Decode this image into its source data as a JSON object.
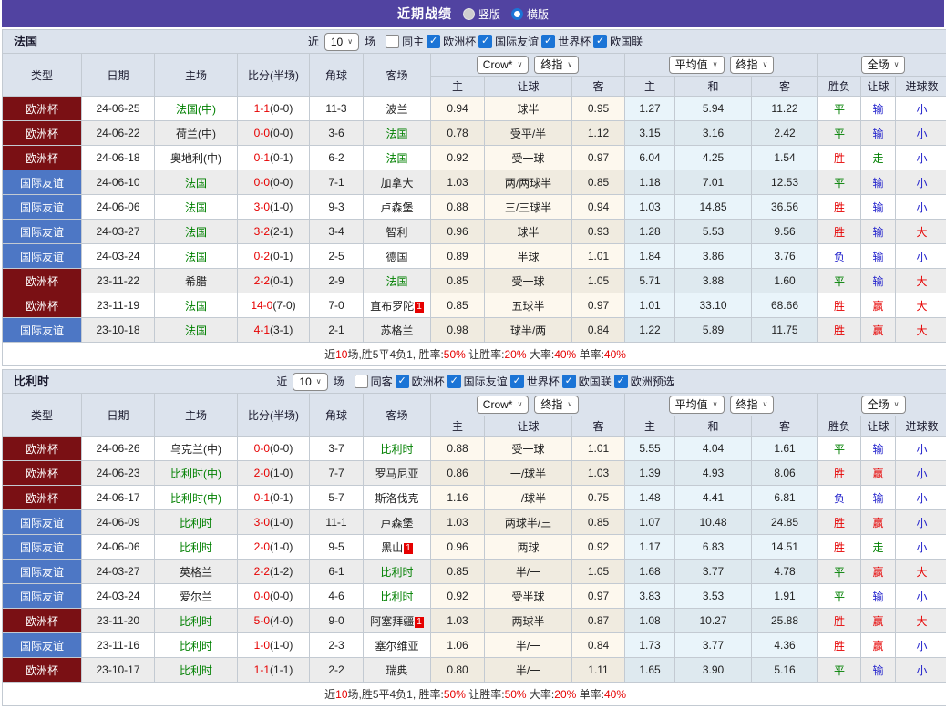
{
  "page": {
    "title": "近期战绩",
    "radios": [
      {
        "label": "竖版",
        "selected": false
      },
      {
        "label": "横版",
        "selected": true
      }
    ]
  },
  "header": {
    "base": [
      "类型",
      "日期",
      "主场",
      "比分(半场)",
      "角球",
      "客场"
    ],
    "groups": [
      {
        "dropdowns": [
          "Crow*",
          "终指"
        ],
        "sub": [
          "主",
          "让球",
          "客"
        ]
      },
      {
        "dropdowns": [
          "平均值",
          "终指"
        ],
        "sub": [
          "主",
          "和",
          "客"
        ]
      },
      {
        "dropdowns": [
          "全场"
        ],
        "sub": [
          "胜负",
          "让球",
          "进球数"
        ]
      }
    ]
  },
  "colors": {
    "topbar": "#5143a1",
    "league_euro": "#7a1014",
    "league_friendly": "#4d77c5",
    "focus_team": "#008000",
    "score": "#e60000",
    "result_map": {
      "胜": "#e60000",
      "平": "#008000",
      "负": "#2222cc",
      "赢": "#e60000",
      "走": "#008000",
      "输": "#2222cc",
      "大": "#e60000",
      "小": "#2222cc"
    }
  },
  "sections": [
    {
      "team": "法国",
      "filter": {
        "prefix": "近",
        "count": "10",
        "suffix": "场",
        "same": {
          "label": "同主",
          "checked": false
        },
        "leagues": [
          {
            "label": "欧洲杯",
            "checked": true
          },
          {
            "label": "国际友谊",
            "checked": true
          },
          {
            "label": "世界杯",
            "checked": true
          },
          {
            "label": "欧国联",
            "checked": true
          }
        ]
      },
      "rows": [
        {
          "league": "欧洲杯",
          "lc": "red",
          "date": "24-06-25",
          "home": "法国(中)",
          "hf": true,
          "score": "1-1",
          "half": "(0-0)",
          "corners": "11-3",
          "away": "波兰",
          "af": false,
          "rc": null,
          "crow": [
            "0.94",
            "球半",
            "0.95"
          ],
          "avg": [
            "1.27",
            "5.94",
            "11.22"
          ],
          "res": [
            "平",
            "输",
            "小"
          ]
        },
        {
          "league": "欧洲杯",
          "lc": "red",
          "date": "24-06-22",
          "home": "荷兰(中)",
          "hf": false,
          "score": "0-0",
          "half": "(0-0)",
          "corners": "3-6",
          "away": "法国",
          "af": true,
          "rc": null,
          "crow": [
            "0.78",
            "受平/半",
            "1.12"
          ],
          "avg": [
            "3.15",
            "3.16",
            "2.42"
          ],
          "res": [
            "平",
            "输",
            "小"
          ]
        },
        {
          "league": "欧洲杯",
          "lc": "red",
          "date": "24-06-18",
          "home": "奥地利(中)",
          "hf": false,
          "score": "0-1",
          "half": "(0-1)",
          "corners": "6-2",
          "away": "法国",
          "af": true,
          "rc": null,
          "crow": [
            "0.92",
            "受一球",
            "0.97"
          ],
          "avg": [
            "6.04",
            "4.25",
            "1.54"
          ],
          "res": [
            "胜",
            "走",
            "小"
          ]
        },
        {
          "league": "国际友谊",
          "lc": "blue",
          "date": "24-06-10",
          "home": "法国",
          "hf": true,
          "score": "0-0",
          "half": "(0-0)",
          "corners": "7-1",
          "away": "加拿大",
          "af": false,
          "rc": null,
          "crow": [
            "1.03",
            "两/两球半",
            "0.85"
          ],
          "avg": [
            "1.18",
            "7.01",
            "12.53"
          ],
          "res": [
            "平",
            "输",
            "小"
          ]
        },
        {
          "league": "国际友谊",
          "lc": "blue",
          "date": "24-06-06",
          "home": "法国",
          "hf": true,
          "score": "3-0",
          "half": "(1-0)",
          "corners": "9-3",
          "away": "卢森堡",
          "af": false,
          "rc": null,
          "crow": [
            "0.88",
            "三/三球半",
            "0.94"
          ],
          "avg": [
            "1.03",
            "14.85",
            "36.56"
          ],
          "res": [
            "胜",
            "输",
            "小"
          ]
        },
        {
          "league": "国际友谊",
          "lc": "blue",
          "date": "24-03-27",
          "home": "法国",
          "hf": true,
          "score": "3-2",
          "half": "(2-1)",
          "corners": "3-4",
          "away": "智利",
          "af": false,
          "rc": null,
          "crow": [
            "0.96",
            "球半",
            "0.93"
          ],
          "avg": [
            "1.28",
            "5.53",
            "9.56"
          ],
          "res": [
            "胜",
            "输",
            "大"
          ]
        },
        {
          "league": "国际友谊",
          "lc": "blue",
          "date": "24-03-24",
          "home": "法国",
          "hf": true,
          "score": "0-2",
          "half": "(0-1)",
          "corners": "2-5",
          "away": "德国",
          "af": false,
          "rc": null,
          "crow": [
            "0.89",
            "半球",
            "1.01"
          ],
          "avg": [
            "1.84",
            "3.86",
            "3.76"
          ],
          "res": [
            "负",
            "输",
            "小"
          ]
        },
        {
          "league": "欧洲杯",
          "lc": "red",
          "date": "23-11-22",
          "home": "希腊",
          "hf": false,
          "score": "2-2",
          "half": "(0-1)",
          "corners": "2-9",
          "away": "法国",
          "af": true,
          "rc": null,
          "crow": [
            "0.85",
            "受一球",
            "1.05"
          ],
          "avg": [
            "5.71",
            "3.88",
            "1.60"
          ],
          "res": [
            "平",
            "输",
            "大"
          ]
        },
        {
          "league": "欧洲杯",
          "lc": "red",
          "date": "23-11-19",
          "home": "法国",
          "hf": true,
          "score": "14-0",
          "half": "(7-0)",
          "corners": "7-0",
          "away": "直布罗陀",
          "af": false,
          "rc": "1",
          "crow": [
            "0.85",
            "五球半",
            "0.97"
          ],
          "avg": [
            "1.01",
            "33.10",
            "68.66"
          ],
          "res": [
            "胜",
            "赢",
            "大"
          ]
        },
        {
          "league": "国际友谊",
          "lc": "blue",
          "date": "23-10-18",
          "home": "法国",
          "hf": true,
          "score": "4-1",
          "half": "(3-1)",
          "corners": "2-1",
          "away": "苏格兰",
          "af": false,
          "rc": null,
          "crow": [
            "0.98",
            "球半/两",
            "0.84"
          ],
          "avg": [
            "1.22",
            "5.89",
            "11.75"
          ],
          "res": [
            "胜",
            "赢",
            "大"
          ]
        }
      ],
      "summary": [
        [
          "近",
          "n"
        ],
        [
          "10",
          "r"
        ],
        [
          "场,胜5平4负1, 胜率:",
          "n"
        ],
        [
          "50%",
          "r"
        ],
        [
          " 让胜率:",
          "n"
        ],
        [
          "20%",
          "r"
        ],
        [
          " 大率:",
          "n"
        ],
        [
          "40%",
          "r"
        ],
        [
          " 单率:",
          "n"
        ],
        [
          "40%",
          "r"
        ]
      ]
    },
    {
      "team": "比利时",
      "filter": {
        "prefix": "近",
        "count": "10",
        "suffix": "场",
        "same": {
          "label": "同客",
          "checked": false
        },
        "leagues": [
          {
            "label": "欧洲杯",
            "checked": true
          },
          {
            "label": "国际友谊",
            "checked": true
          },
          {
            "label": "世界杯",
            "checked": true
          },
          {
            "label": "欧国联",
            "checked": true
          },
          {
            "label": "欧洲预选",
            "checked": true
          }
        ]
      },
      "rows": [
        {
          "league": "欧洲杯",
          "lc": "red",
          "date": "24-06-26",
          "home": "乌克兰(中)",
          "hf": false,
          "score": "0-0",
          "half": "(0-0)",
          "corners": "3-7",
          "away": "比利时",
          "af": true,
          "rc": null,
          "crow": [
            "0.88",
            "受一球",
            "1.01"
          ],
          "avg": [
            "5.55",
            "4.04",
            "1.61"
          ],
          "res": [
            "平",
            "输",
            "小"
          ]
        },
        {
          "league": "欧洲杯",
          "lc": "red",
          "date": "24-06-23",
          "home": "比利时(中)",
          "hf": true,
          "score": "2-0",
          "half": "(1-0)",
          "corners": "7-7",
          "away": "罗马尼亚",
          "af": false,
          "rc": null,
          "crow": [
            "0.86",
            "一/球半",
            "1.03"
          ],
          "avg": [
            "1.39",
            "4.93",
            "8.06"
          ],
          "res": [
            "胜",
            "赢",
            "小"
          ]
        },
        {
          "league": "欧洲杯",
          "lc": "red",
          "date": "24-06-17",
          "home": "比利时(中)",
          "hf": true,
          "score": "0-1",
          "half": "(0-1)",
          "corners": "5-7",
          "away": "斯洛伐克",
          "af": false,
          "rc": null,
          "crow": [
            "1.16",
            "一/球半",
            "0.75"
          ],
          "avg": [
            "1.48",
            "4.41",
            "6.81"
          ],
          "res": [
            "负",
            "输",
            "小"
          ]
        },
        {
          "league": "国际友谊",
          "lc": "blue",
          "date": "24-06-09",
          "home": "比利时",
          "hf": true,
          "score": "3-0",
          "half": "(1-0)",
          "corners": "11-1",
          "away": "卢森堡",
          "af": false,
          "rc": null,
          "crow": [
            "1.03",
            "两球半/三",
            "0.85"
          ],
          "avg": [
            "1.07",
            "10.48",
            "24.85"
          ],
          "res": [
            "胜",
            "赢",
            "小"
          ]
        },
        {
          "league": "国际友谊",
          "lc": "blue",
          "date": "24-06-06",
          "home": "比利时",
          "hf": true,
          "score": "2-0",
          "half": "(1-0)",
          "corners": "9-5",
          "away": "黑山",
          "af": false,
          "rc": "1",
          "crow": [
            "0.96",
            "两球",
            "0.92"
          ],
          "avg": [
            "1.17",
            "6.83",
            "14.51"
          ],
          "res": [
            "胜",
            "走",
            "小"
          ]
        },
        {
          "league": "国际友谊",
          "lc": "blue",
          "date": "24-03-27",
          "home": "英格兰",
          "hf": false,
          "score": "2-2",
          "half": "(1-2)",
          "corners": "6-1",
          "away": "比利时",
          "af": true,
          "rc": null,
          "crow": [
            "0.85",
            "半/一",
            "1.05"
          ],
          "avg": [
            "1.68",
            "3.77",
            "4.78"
          ],
          "res": [
            "平",
            "赢",
            "大"
          ]
        },
        {
          "league": "国际友谊",
          "lc": "blue",
          "date": "24-03-24",
          "home": "爱尔兰",
          "hf": false,
          "score": "0-0",
          "half": "(0-0)",
          "corners": "4-6",
          "away": "比利时",
          "af": true,
          "rc": null,
          "crow": [
            "0.92",
            "受半球",
            "0.97"
          ],
          "avg": [
            "3.83",
            "3.53",
            "1.91"
          ],
          "res": [
            "平",
            "输",
            "小"
          ]
        },
        {
          "league": "欧洲杯",
          "lc": "red",
          "date": "23-11-20",
          "home": "比利时",
          "hf": true,
          "score": "5-0",
          "half": "(4-0)",
          "corners": "9-0",
          "away": "阿塞拜疆",
          "af": false,
          "rc": "1",
          "crow": [
            "1.03",
            "两球半",
            "0.87"
          ],
          "avg": [
            "1.08",
            "10.27",
            "25.88"
          ],
          "res": [
            "胜",
            "赢",
            "大"
          ]
        },
        {
          "league": "国际友谊",
          "lc": "blue",
          "date": "23-11-16",
          "home": "比利时",
          "hf": true,
          "score": "1-0",
          "half": "(1-0)",
          "corners": "2-3",
          "away": "塞尔维亚",
          "af": false,
          "rc": null,
          "crow": [
            "1.06",
            "半/一",
            "0.84"
          ],
          "avg": [
            "1.73",
            "3.77",
            "4.36"
          ],
          "res": [
            "胜",
            "赢",
            "小"
          ]
        },
        {
          "league": "欧洲杯",
          "lc": "red",
          "date": "23-10-17",
          "home": "比利时",
          "hf": true,
          "score": "1-1",
          "half": "(1-1)",
          "corners": "2-2",
          "away": "瑞典",
          "af": false,
          "rc": null,
          "crow": [
            "0.80",
            "半/一",
            "1.11"
          ],
          "avg": [
            "1.65",
            "3.90",
            "5.16"
          ],
          "res": [
            "平",
            "输",
            "小"
          ]
        }
      ],
      "summary": [
        [
          "近",
          "n"
        ],
        [
          "10",
          "r"
        ],
        [
          "场,胜5平4负1, 胜率:",
          "n"
        ],
        [
          "50%",
          "r"
        ],
        [
          " 让胜率:",
          "n"
        ],
        [
          "50%",
          "r"
        ],
        [
          " 大率:",
          "n"
        ],
        [
          "20%",
          "r"
        ],
        [
          " 单率:",
          "n"
        ],
        [
          "40%",
          "r"
        ]
      ]
    }
  ]
}
